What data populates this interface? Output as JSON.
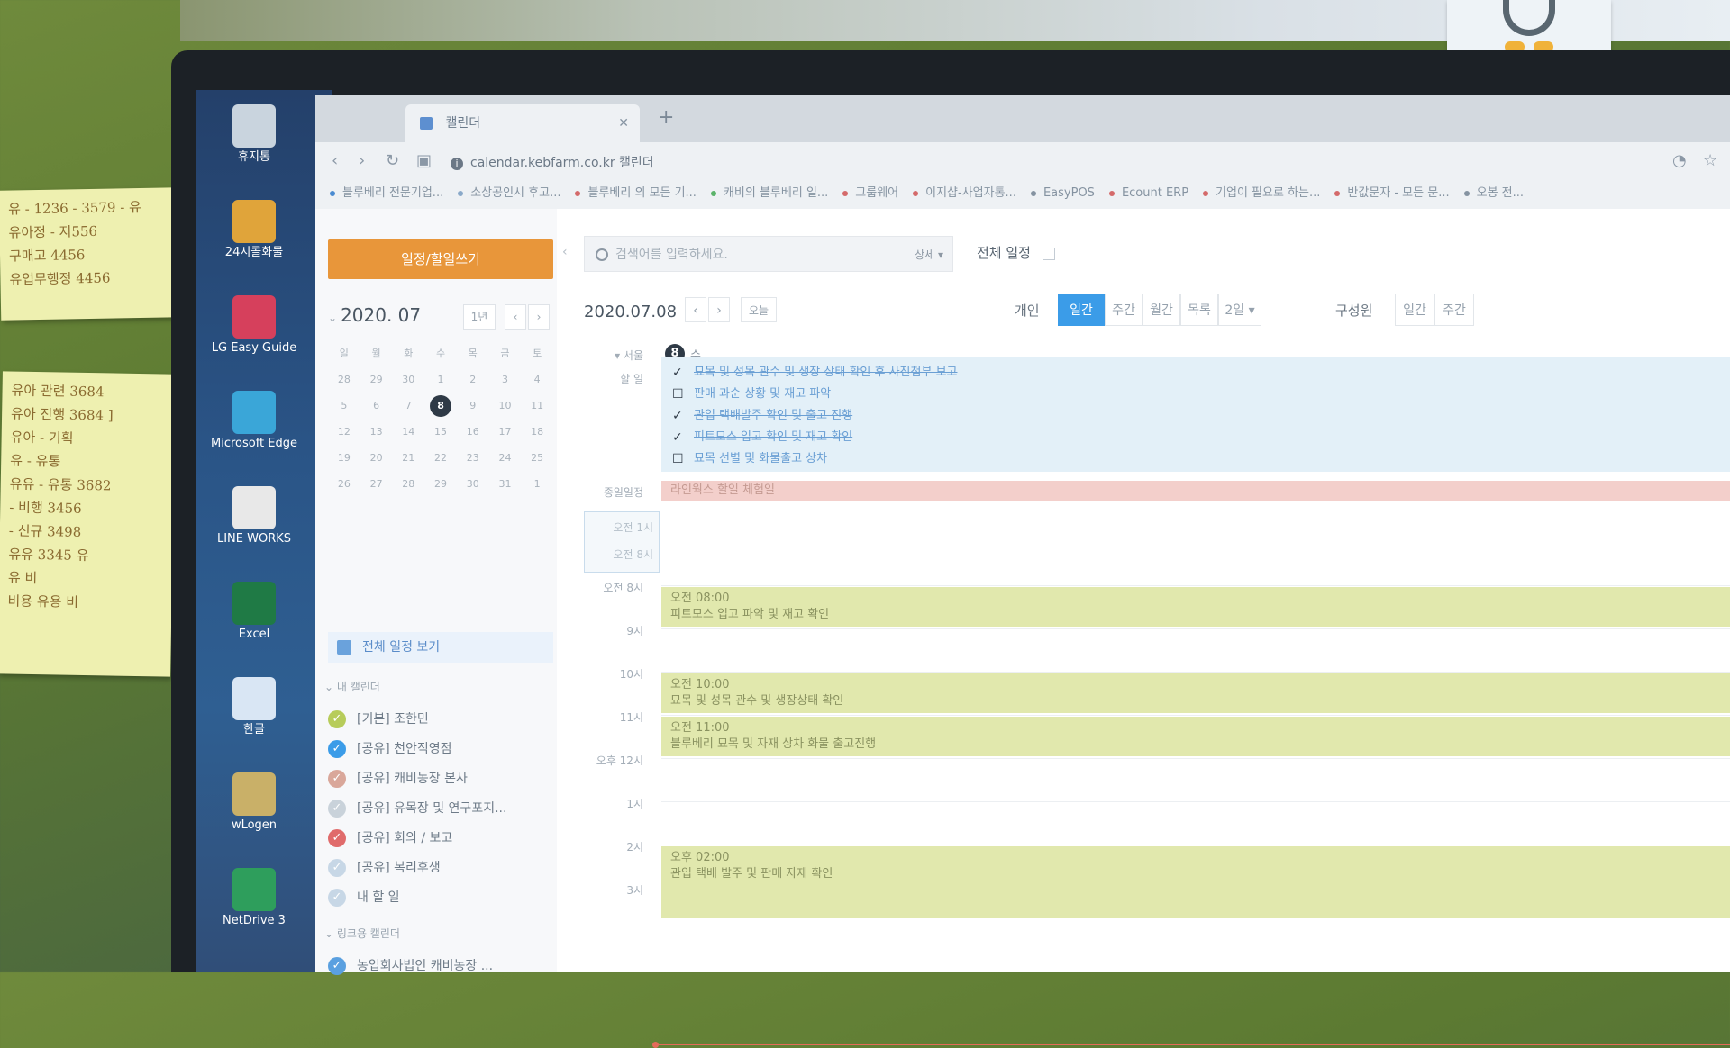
{
  "stickies": {
    "note1_lines": [
      "유 - 1236 - 3579 - 유",
      "유아정 - 저556",
      "구매고 4456",
      "유업무행정 4456"
    ],
    "note2_lines": [
      "유아 관련 3684",
      "유아 진행 3684 ]",
      "유아 - 기획",
      "유 - 유통",
      "유유 - 유통 3682",
      "- 비행 3456",
      "- 신규 3498",
      "유유 3345 유",
      "유 비",
      "비용 유용 비"
    ]
  },
  "desktop_icons": [
    {
      "label": "휴지통",
      "icon": "recycle-bin-icon",
      "color": "#c9d4de"
    },
    {
      "label": "24시콜화물",
      "icon": "app-24-icon",
      "color": "#e0a43a"
    },
    {
      "label": "LG Easy Guide",
      "icon": "lg-guide-icon",
      "color": "#d6405c"
    },
    {
      "label": "Microsoft Edge",
      "icon": "edge-icon",
      "color": "#3aa6d8"
    },
    {
      "label": "LINE WORKS",
      "icon": "line-works-icon",
      "color": "#e8e8e8"
    },
    {
      "label": "Excel",
      "icon": "excel-icon",
      "color": "#1f7a45"
    },
    {
      "label": "한글",
      "icon": "hangul-icon",
      "color": "#d9e6f4"
    },
    {
      "label": "wLogen",
      "icon": "wlogen-icon",
      "color": "#c9b068"
    },
    {
      "label": "NetDrive 3",
      "icon": "netdrive-icon",
      "color": "#2e9e5c"
    }
  ],
  "browser": {
    "tab_title": "캘린더",
    "url": "calendar.kebfarm.co.kr  캘린더",
    "bookmarks": [
      "블루베리 전문기업...",
      "소상공인시 후고...",
      "블루베리 의 모든 기...",
      "캐비의 블루베리 일...",
      "그룹웨어",
      "이지샵-사업자통...",
      "EasyPOS",
      "Ecount ERP",
      "기업이 필요로 하는...",
      "반값문자 - 모든 문...",
      "오봉 전..."
    ]
  },
  "sidebar": {
    "compose_label": "일정/할일쓰기",
    "mini_month": "2020. 07",
    "mini_view_label": "1년",
    "weekdays": [
      "일",
      "월",
      "화",
      "수",
      "목",
      "금",
      "토"
    ],
    "weeks": [
      [
        "28",
        "29",
        "30",
        "1",
        "2",
        "3",
        "4"
      ],
      [
        "5",
        "6",
        "7",
        "8",
        "9",
        "10",
        "11"
      ],
      [
        "12",
        "13",
        "14",
        "15",
        "16",
        "17",
        "18"
      ],
      [
        "19",
        "20",
        "21",
        "22",
        "23",
        "24",
        "25"
      ],
      [
        "26",
        "27",
        "28",
        "29",
        "30",
        "31",
        "1"
      ]
    ],
    "today": "8",
    "all_view_label": "전체 일정 보기",
    "my_calendars_label": "내 캘린더",
    "calendars": [
      {
        "label": "[기본] 조한민",
        "color": "#b7cc5a"
      },
      {
        "label": "[공유] 천안직영점",
        "color": "#3b9ce8"
      },
      {
        "label": "[공유] 캐비농장 본사",
        "color": "#d9a79a"
      },
      {
        "label": "[공유] 유목장 및 연구포지...",
        "color": "#c9d2da"
      },
      {
        "label": "[공유] 회의 / 보고",
        "color": "#e06b6b"
      },
      {
        "label": "[공유] 복리후생",
        "color": "#c7d7e6"
      },
      {
        "label": "내 할 일",
        "color": "#c7d7e6"
      }
    ],
    "linked_label": "링크용 캘린더",
    "linked": [
      {
        "label": "농업회사법인 캐비농장 ...",
        "color": "#5aa0e0"
      }
    ]
  },
  "main": {
    "search_placeholder": "검색어를 입력하세요.",
    "search_adv": "상세 ▾",
    "all_title": "전체 일정",
    "current_date": "2020.07.08",
    "today_label": "오늘",
    "personal_label": "개인",
    "views": [
      "일간",
      "주간",
      "월간",
      "목록",
      "2일 ▾"
    ],
    "active_view": "일간",
    "members_label": "구성원",
    "member_views": [
      "일간",
      "주간"
    ],
    "day_number": "8",
    "day_name": "수",
    "timezone_label": "▾ 서울",
    "tasks_label": "할 일",
    "tasks": [
      {
        "text": "묘목 및 성목 관수 및 생장 상태 확인 후 사진첨부 보고",
        "done": true
      },
      {
        "text": "판매 과순 상황 및 재고 파악",
        "done": false
      },
      {
        "text": "관입 택배발주 확인 및 출고 진행",
        "done": true
      },
      {
        "text": "피트모스 입고 확인 및 재고 확인",
        "done": true
      },
      {
        "text": "묘목 선별 및 화물출고 상차",
        "done": false
      }
    ],
    "allday_label": "종일일정",
    "allday_event": "라인웍스 할일 체험일",
    "early_labels": [
      "오전 1시",
      "오전 8시"
    ],
    "hours": [
      {
        "label": "오전 8시"
      },
      {
        "label": "9시"
      },
      {
        "label": "10시"
      },
      {
        "label": "11시"
      },
      {
        "label": "오후 12시"
      },
      {
        "label": "1시"
      },
      {
        "label": "2시"
      },
      {
        "label": "3시"
      }
    ],
    "events": [
      {
        "time": "오전 08:00",
        "title": "피트모스 입고 파악 및 재고 확인"
      },
      {
        "time": "오전 10:00",
        "title": "묘목 및 성목 관수 및 생장상태 확인"
      },
      {
        "time": "오전 11:00",
        "title": "블루베리 묘목 및 자재 상차 화물 출고진행"
      },
      {
        "time": "오후 02:00",
        "title": "관입 택배 발주 및 판매 자재 확인"
      }
    ]
  }
}
